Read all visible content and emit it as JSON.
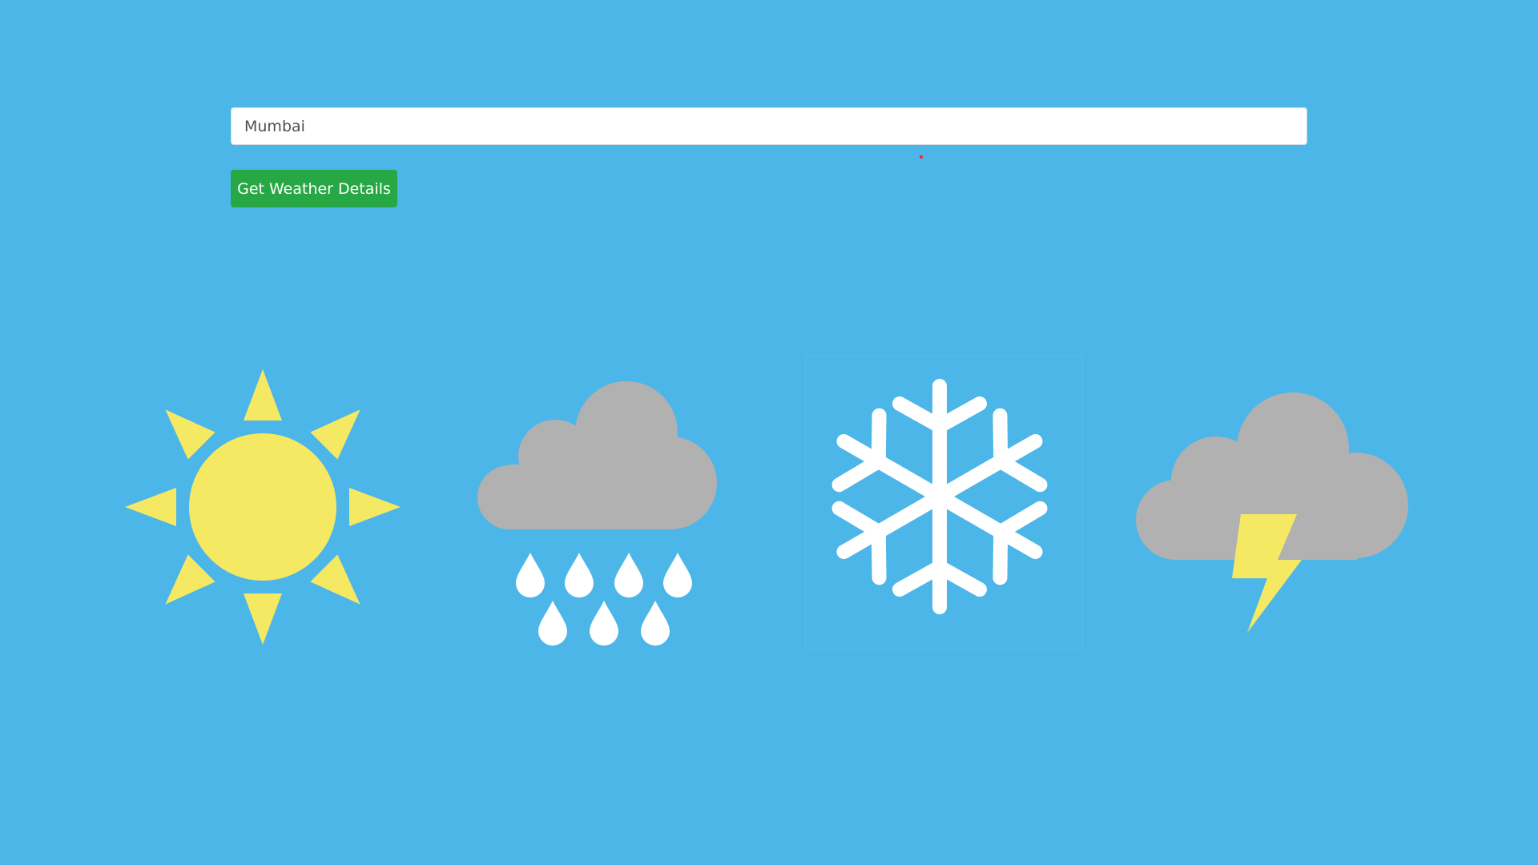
{
  "search": {
    "value": "Mumbai"
  },
  "actions": {
    "get_weather_label": "Get Weather Details"
  },
  "weather_icons": [
    {
      "name": "sun-icon",
      "color": "#f5e964"
    },
    {
      "name": "rain-cloud-icon",
      "cloud_color": "#b1b1b1",
      "drop_color": "#ffffff"
    },
    {
      "name": "snowflake-icon",
      "color": "#ffffff"
    },
    {
      "name": "thunderstorm-icon",
      "cloud_color": "#b1b1b1",
      "bolt_color": "#f5e964"
    }
  ],
  "theme": {
    "background": "#4db6e8",
    "button_color": "#28a745"
  }
}
